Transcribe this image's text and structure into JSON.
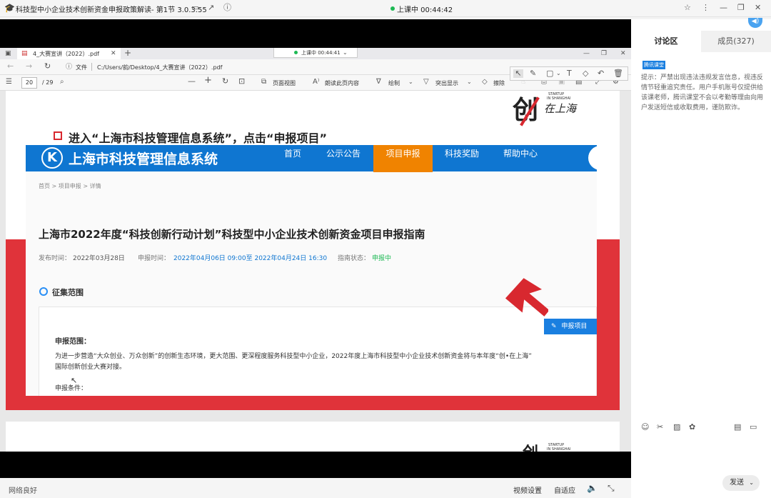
{
  "app": {
    "title": "科技型中小企业技术创新资金申报政策解读- 第1节 3.0.3.55",
    "class_status": "上课中 00:44:42"
  },
  "edge": {
    "tab_title": "4_大赛宣讲（2022）.pdf",
    "class_pill": "上课中 00:44:41",
    "file_label": "文件",
    "path": "C:/Users/韵/Desktop/4_大赛宣讲（2022）.pdf",
    "page_current": "20",
    "page_total": "/ 29",
    "page_view": "页面视图",
    "read_aloud": "朗读此页内容",
    "draw": "绘制",
    "highlight": "突出显示",
    "erase": "擦除"
  },
  "slide": {
    "heading": "进入“上海市科技管理信息系统”，点击“申报项目”",
    "logo_text": "在上海",
    "logo_sub1": "STARTUP",
    "logo_sub2": "IN SHANGHAI",
    "site_title": "上海市科技管理信息系统",
    "nav": [
      "首页",
      "公示公告",
      "项目申报",
      "科技奖励",
      "帮助中心"
    ],
    "breadcrumb": "首页 > 项目申报 > 详情",
    "page_title": "上海市2022年度“科技创新行动计划”科技型中小企业技术创新资金项目申报指南",
    "publish_label": "发布时间：",
    "publish_date": "2022年03月28日",
    "apply_label": "申报时间：",
    "apply_range": "2022年04月06日 09:00至 2022年04月24日 16:30",
    "status_label": "指南状态：",
    "status_value": "申报中",
    "section": "征集范围",
    "apply_button": "申报项目",
    "scope_title": "申报范围：",
    "scope_text_1": "为进一步营造“大众创业、万众创新”的创新生态环境，更大范围、更深程度服务科技型中小企业，2022年度上海市科技型中小企业技术创新资金将与本年度“创•在上海”",
    "scope_text_2": "国际创新创业大赛对接。",
    "cond_title": "申报条件："
  },
  "side": {
    "tab_discuss": "讨论区",
    "tab_members": "成员(327)",
    "badge": "腾讯课堂",
    "notice": "提示：严禁出现违法违规发言信息，视违反情节轻重追究责任。用户手机账号仅提供给该课老师，腾讯课堂不会以考勤等理由向用户发送短信或收取费用，谨防欺诈。",
    "send": "发送"
  },
  "status": {
    "network": "网络良好",
    "video_settings": "视频设置",
    "adaptive": "自适应"
  },
  "colors": {
    "site_blue": "#0f76d1",
    "nav_active": "#f08300",
    "slide_red": "#e0333a",
    "green": "#1db954",
    "side_tab_bg": "#f1f1f1"
  }
}
